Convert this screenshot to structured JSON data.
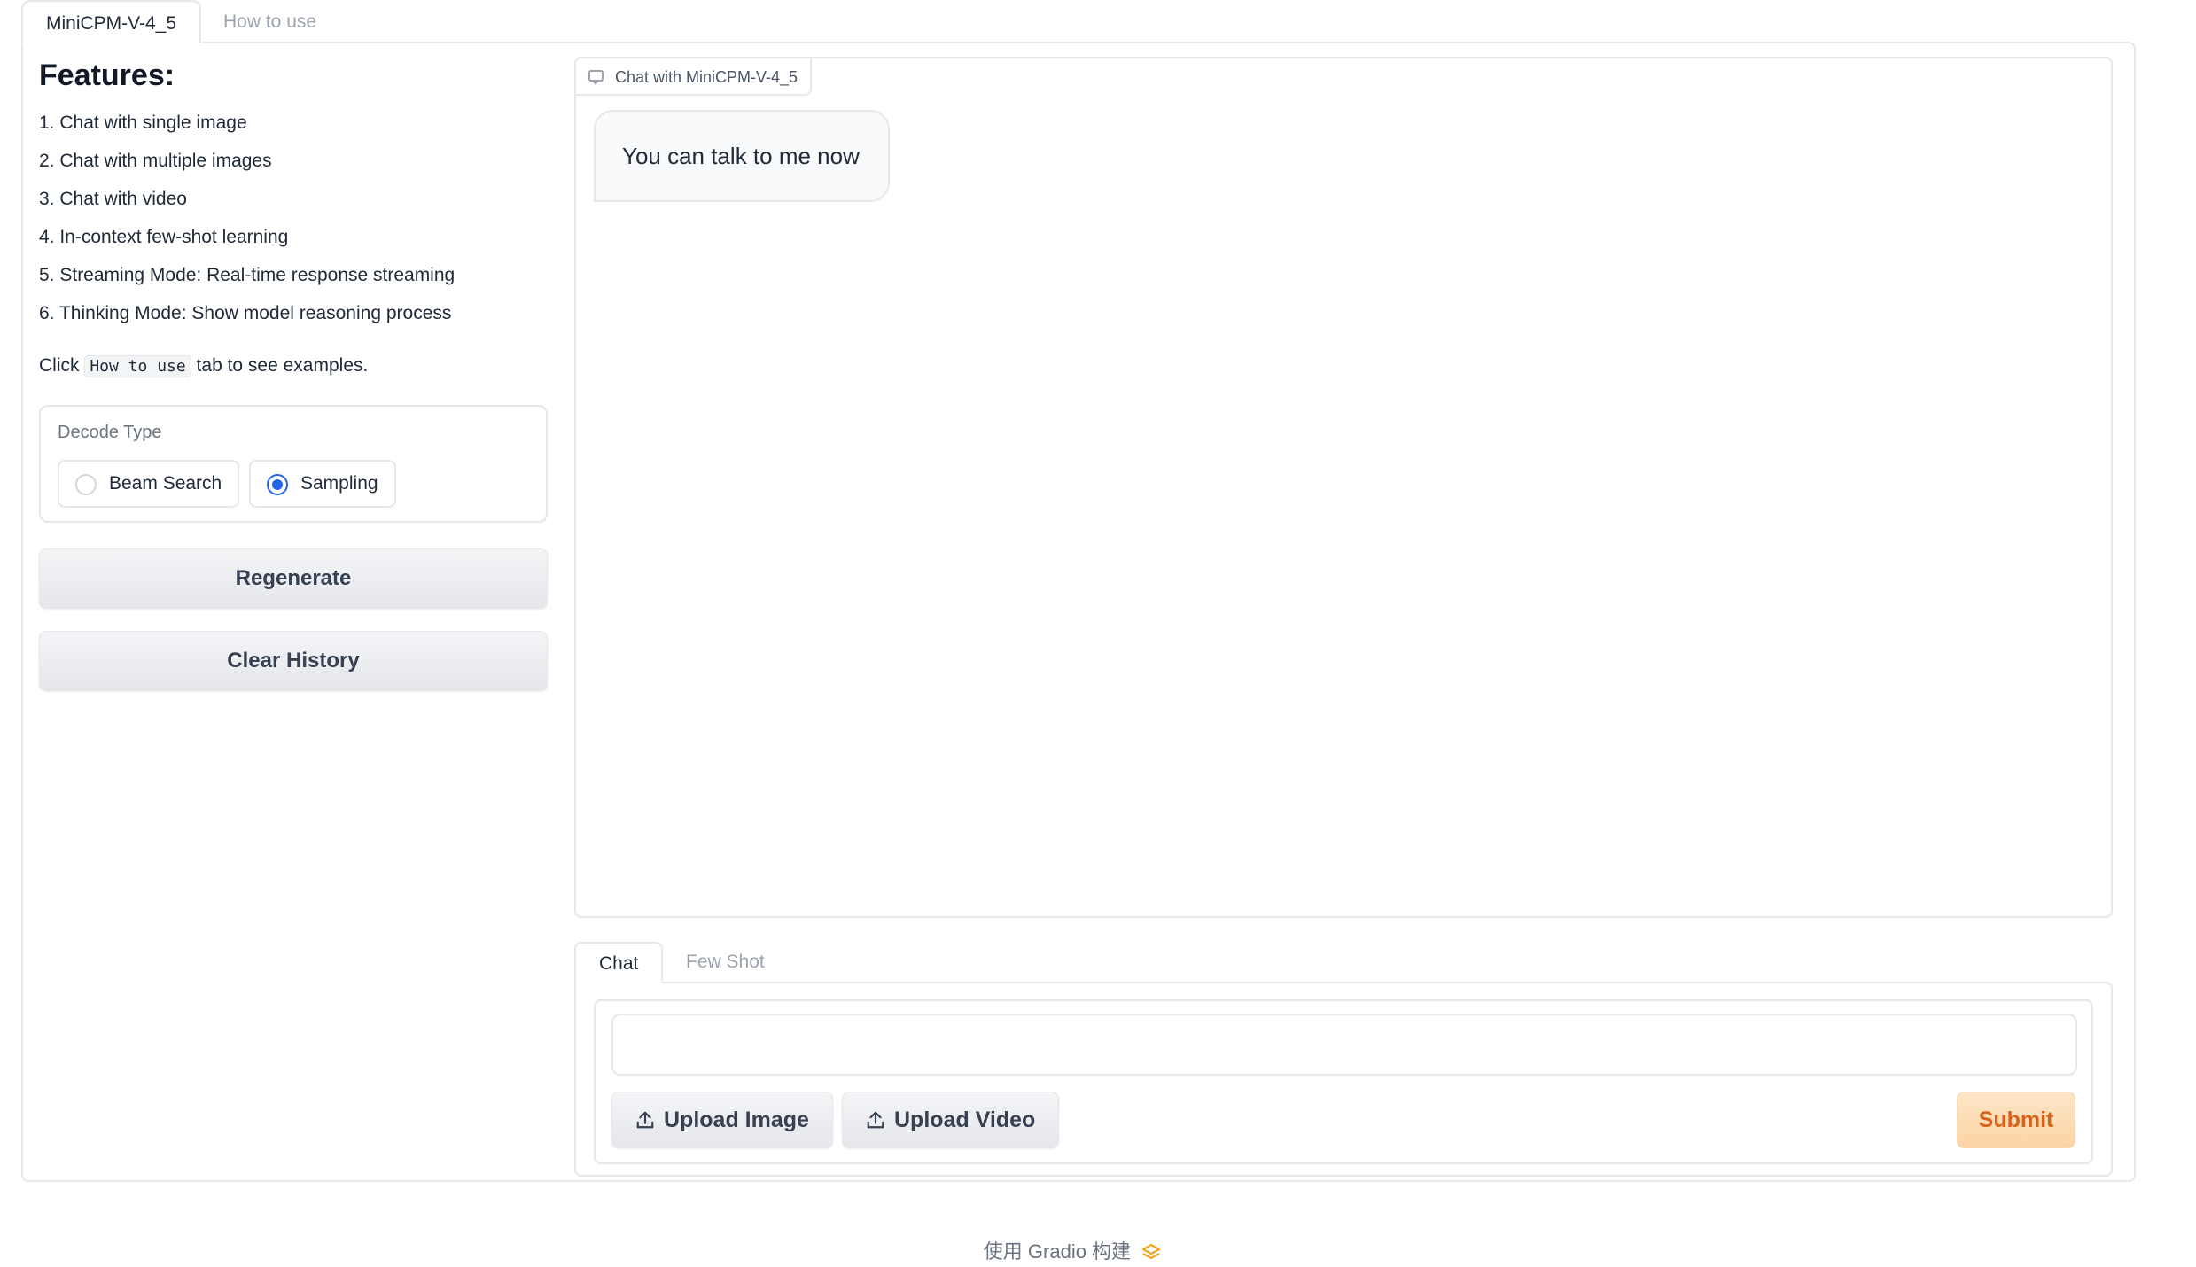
{
  "top_tabs": [
    {
      "label": "MiniCPM-V-4_5",
      "active": true
    },
    {
      "label": "How to use",
      "active": false
    }
  ],
  "features": {
    "title": "Features:",
    "items": [
      "1. Chat with single image",
      "2. Chat with multiple images",
      "3. Chat with video",
      "4. In-context few-shot learning",
      "5. Streaming Mode: Real-time response streaming",
      "6. Thinking Mode: Show model reasoning process"
    ],
    "note_before": "Click ",
    "note_code": "How to use",
    "note_after": " tab to see examples."
  },
  "decode": {
    "label": "Decode Type",
    "options": [
      {
        "label": "Beam Search",
        "checked": false
      },
      {
        "label": "Sampling",
        "checked": true
      }
    ]
  },
  "buttons": {
    "regenerate": "Regenerate",
    "clear_history": "Clear History"
  },
  "chat": {
    "label": "Chat with MiniCPM-V-4_5",
    "messages": [
      {
        "role": "assistant",
        "text": "You can talk to me now"
      }
    ]
  },
  "input_tabs": [
    {
      "label": "Chat",
      "active": true
    },
    {
      "label": "Few Shot",
      "active": false
    }
  ],
  "input": {
    "value": "",
    "placeholder": "",
    "upload_image": "Upload Image",
    "upload_video": "Upload Video",
    "submit": "Submit"
  },
  "footer": {
    "text": "使用 Gradio 构建",
    "icon": "gradio-logo-icon"
  },
  "colors": {
    "accent": "#2563eb",
    "submit_text": "#d9621a",
    "submit_bg": "#fbd3a3",
    "border": "#e5e7eb"
  }
}
